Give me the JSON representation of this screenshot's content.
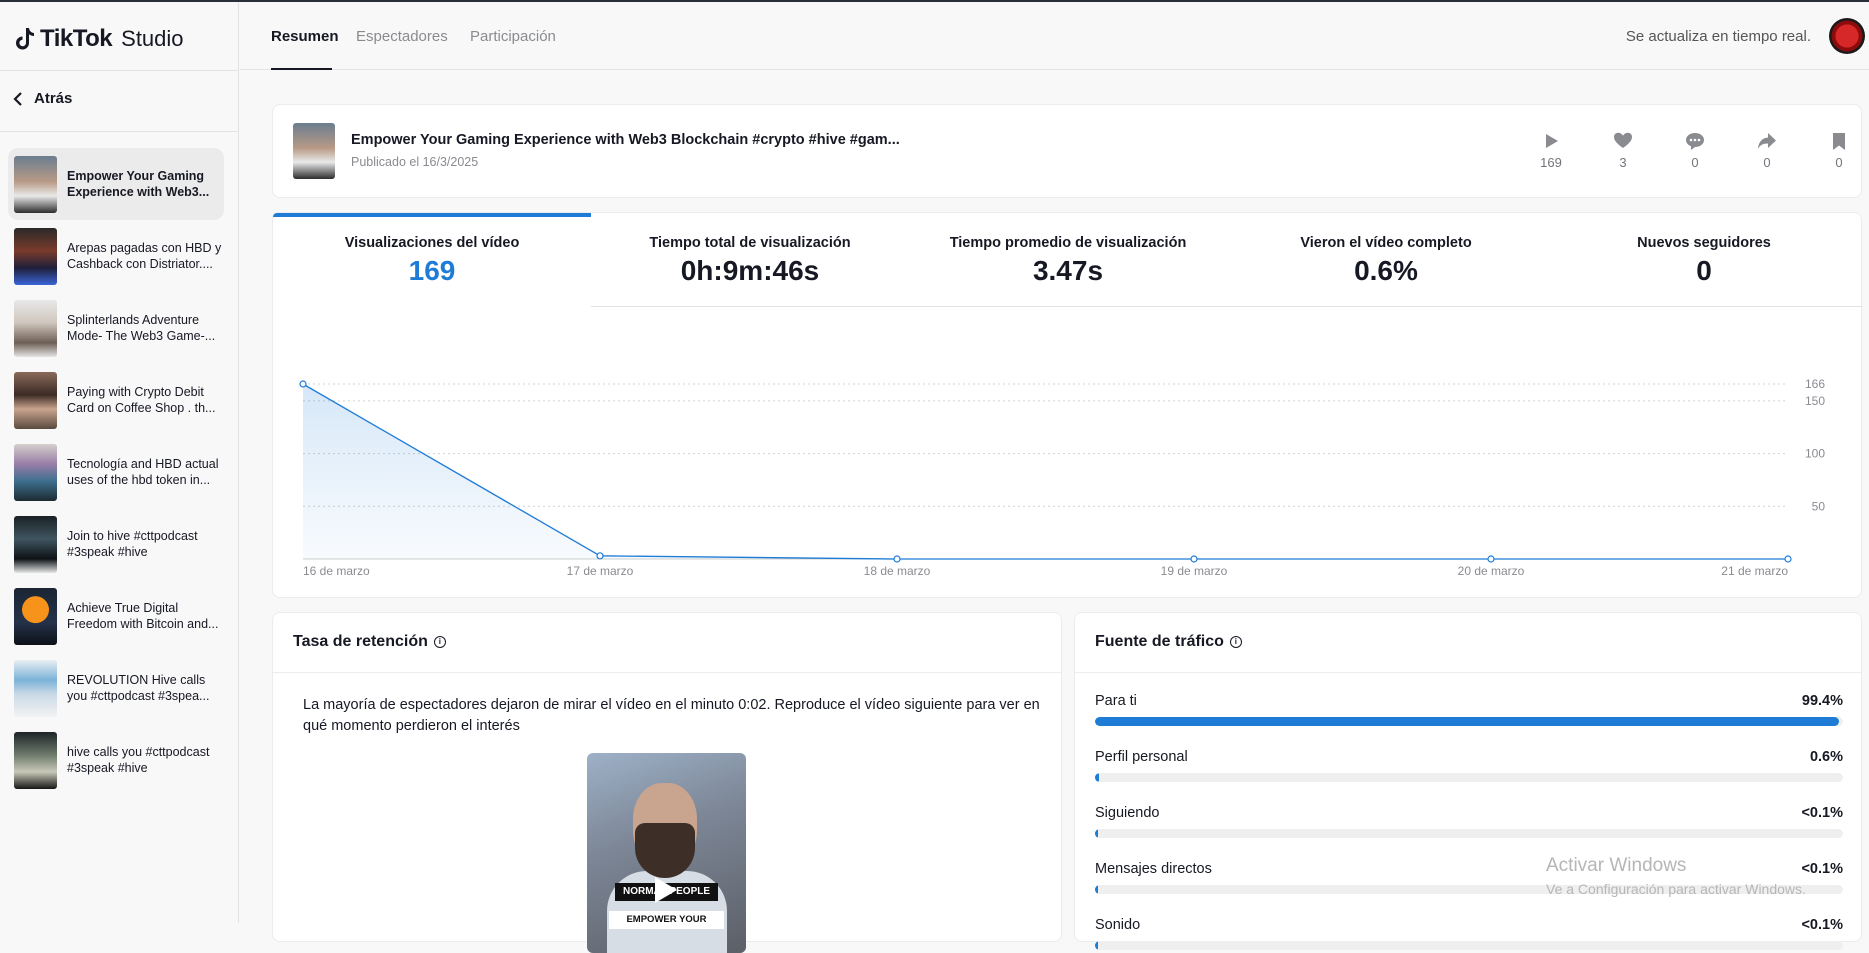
{
  "app": {
    "brand": "TikTok",
    "product": "Studio"
  },
  "sidebar": {
    "back_label": "Atrás",
    "videos": [
      {
        "title": "Empower Your Gaming Experience with Web3...",
        "active": true
      },
      {
        "title": "Arepas pagadas con HBD y Cashback con Distriator...."
      },
      {
        "title": "Splinterlands Adventure Mode- The Web3 Game-..."
      },
      {
        "title": "Paying with Crypto Debit Card on Coffee Shop . th..."
      },
      {
        "title": "Tecnología and HBD actual uses of the hbd token in..."
      },
      {
        "title": "Join to hive #cttpodcast #3speak #hive"
      },
      {
        "title": "Achieve True Digital Freedom with Bitcoin and..."
      },
      {
        "title": "REVOLUTION Hive calls you #cttpodcast #3spea..."
      },
      {
        "title": "hive calls you #cttpodcast #3speak #hive"
      }
    ]
  },
  "tabs": [
    {
      "label": "Resumen",
      "active": true
    },
    {
      "label": "Espectadores"
    },
    {
      "label": "Participación"
    }
  ],
  "realtime_label": "Se actualiza en tiempo real.",
  "video": {
    "title": "Empower Your Gaming Experience with Web3 Blockchain #crypto #hive #gam...",
    "published": "Publicado el 16/3/2025",
    "stats": {
      "plays": "169",
      "likes": "3",
      "comments": "0",
      "shares": "0",
      "saves": "0"
    }
  },
  "metrics": [
    {
      "label": "Visualizaciones del vídeo",
      "value": "169",
      "active": true
    },
    {
      "label": "Tiempo total de visualización",
      "value": "0h:9m:46s"
    },
    {
      "label": "Tiempo promedio de visualización",
      "value": "3.47s"
    },
    {
      "label": "Vieron el vídeo completo",
      "value": "0.6%"
    },
    {
      "label": "Nuevos seguidores",
      "value": "0"
    }
  ],
  "chart_data": {
    "type": "area",
    "x": [
      "16 de marzo",
      "17 de marzo",
      "18 de marzo",
      "19 de marzo",
      "20 de marzo",
      "21 de marzo"
    ],
    "values": [
      166,
      3,
      0,
      0,
      0,
      0
    ],
    "yticks": [
      50,
      100,
      150,
      166
    ],
    "ylim": [
      0,
      166
    ],
    "grid": true,
    "color": "#1e7cd6"
  },
  "retention": {
    "title": "Tasa de retención",
    "text": "La mayoría de espectadores dejaron de mirar el vídeo en el minuto 0:02. Reproduce el vídeo siguiente para ver en qué momento perdieron el interés",
    "caption1": "NORMAL PEOPLE",
    "caption2": "EMPOWER YOUR"
  },
  "traffic": {
    "title": "Fuente de tráfico",
    "sources": [
      {
        "label": "Para ti",
        "value": "99.4%",
        "fraction": 0.994
      },
      {
        "label": "Perfil personal",
        "value": "0.6%",
        "fraction": 0.006
      },
      {
        "label": "Siguiendo",
        "value": "<0.1%",
        "fraction": 0
      },
      {
        "label": "Mensajes directos",
        "value": "<0.1%",
        "fraction": 0
      },
      {
        "label": "Sonido",
        "value": "<0.1%",
        "fraction": 0
      }
    ]
  },
  "watermark": {
    "line1": "Activar Windows",
    "line2": "Ve a Configuración para activar Windows."
  },
  "colors": {
    "accent": "#1e7cd6",
    "text": "#161823",
    "muted": "#8a8b91"
  }
}
